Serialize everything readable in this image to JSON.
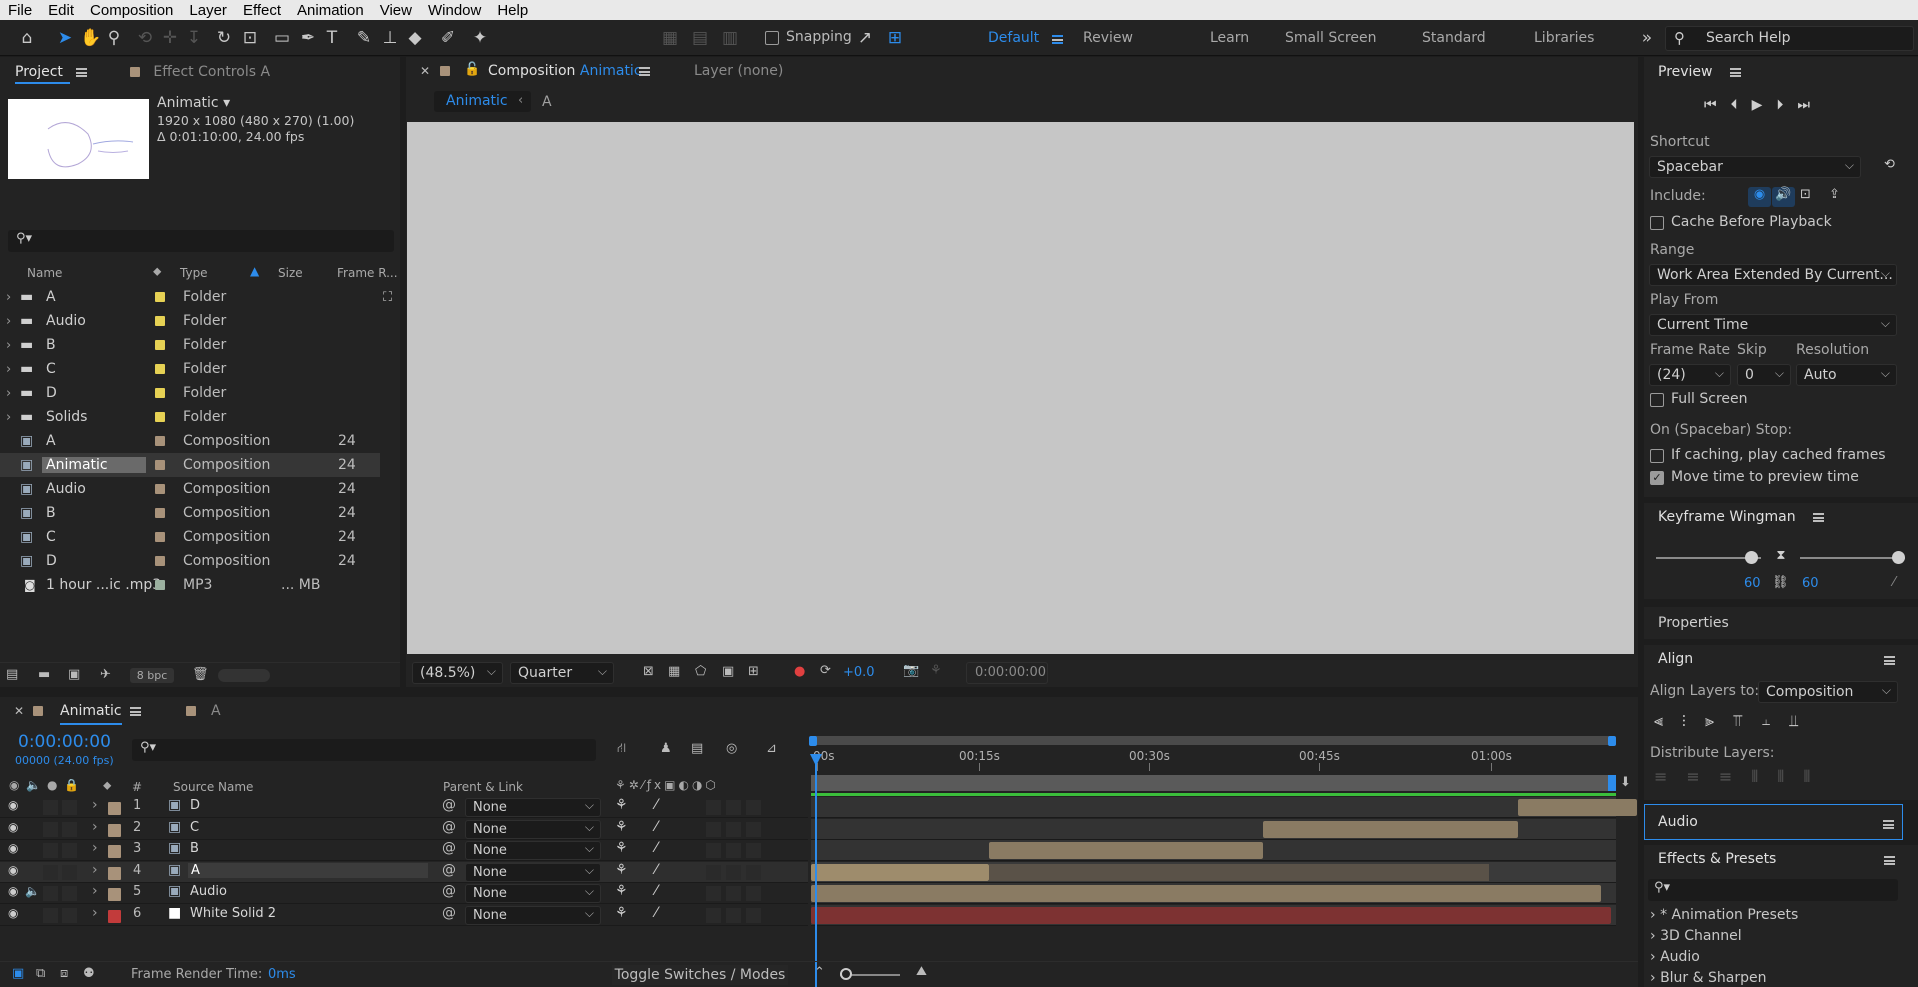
{
  "menu": [
    "File",
    "Edit",
    "Composition",
    "Layer",
    "Effect",
    "Animation",
    "View",
    "Window",
    "Help"
  ],
  "toolbar": {
    "snapping": "Snapping",
    "search_placeholder": "Search Help"
  },
  "workspaces": [
    {
      "label": "Default",
      "active": true
    },
    {
      "label": "Review"
    },
    {
      "label": "Learn"
    },
    {
      "label": "Small Screen"
    },
    {
      "label": "Standard"
    },
    {
      "label": "Libraries"
    }
  ],
  "project": {
    "tab_project": "Project",
    "tab_effect": "Effect Controls A",
    "comp_name": "Animatic",
    "comp_res": "1920 x 1080  (480 x 270) (1.00)",
    "comp_dur": "Δ 0:01:10:00, 24.00 fps",
    "columns": [
      "Name",
      "Type",
      "Size",
      "Frame R..."
    ],
    "bpc": "8 bpc",
    "items": [
      {
        "name": "A",
        "type": "Folder",
        "kind": "folder",
        "color": "#e6d154"
      },
      {
        "name": "Audio",
        "type": "Folder",
        "kind": "folder",
        "color": "#e6d154"
      },
      {
        "name": "B",
        "type": "Folder",
        "kind": "folder",
        "color": "#e6d154"
      },
      {
        "name": "C",
        "type": "Folder",
        "kind": "folder",
        "color": "#e6d154"
      },
      {
        "name": "D",
        "type": "Folder",
        "kind": "folder",
        "color": "#e6d154"
      },
      {
        "name": "Solids",
        "type": "Folder",
        "kind": "folder",
        "color": "#e6d154"
      },
      {
        "name": "A",
        "type": "Composition",
        "kind": "comp",
        "color": "#a8927a",
        "fr": "24"
      },
      {
        "name": "Animatic",
        "type": "Composition",
        "kind": "comp",
        "color": "#a8927a",
        "fr": "24",
        "selected": true
      },
      {
        "name": "Audio",
        "type": "Composition",
        "kind": "comp",
        "color": "#a8927a",
        "fr": "24"
      },
      {
        "name": "B",
        "type": "Composition",
        "kind": "comp",
        "color": "#a8927a",
        "fr": "24"
      },
      {
        "name": "C",
        "type": "Composition",
        "kind": "comp",
        "color": "#a8927a",
        "fr": "24"
      },
      {
        "name": "D",
        "type": "Composition",
        "kind": "comp",
        "color": "#a8927a",
        "fr": "24"
      },
      {
        "name": "1 hour ...ic .mp3",
        "type": "MP3",
        "kind": "mp3",
        "color": "#9bb09f",
        "size": "... MB"
      }
    ]
  },
  "composition": {
    "tab_prefix": "Composition",
    "tab_name": "Animatic",
    "layer_tab": "Layer  (none)",
    "crumbs": [
      "Animatic",
      "A"
    ],
    "zoom": "(48.5%)",
    "quality": "Quarter",
    "exposure": "+0.0",
    "timecode": "0:00:00:00"
  },
  "timeline": {
    "tab": "Animatic",
    "tab2": "A",
    "time": "0:00:00:00",
    "frames": "00000 (24.00 fps)",
    "col_source": "Source Name",
    "col_parent": "Parent & Link",
    "col_num": "#",
    "ticks": [
      "00s",
      "00:15s",
      "00:30s",
      "00:45s",
      "01:00s"
    ],
    "layers": [
      {
        "num": "1",
        "name": "D",
        "parent": "None",
        "color": "#a8927a",
        "bar_start": 707,
        "bar_end": 826
      },
      {
        "num": "2",
        "name": "C",
        "parent": "None",
        "color": "#a8927a",
        "bar_start": 452,
        "bar_end": 707
      },
      {
        "num": "3",
        "name": "B",
        "parent": "None",
        "color": "#a8927a",
        "bar_start": 178,
        "bar_end": 452
      },
      {
        "num": "4",
        "name": "A",
        "parent": "None",
        "color": "#a8927a",
        "bar_start": 0,
        "bar_end": 178,
        "selected": true
      },
      {
        "num": "5",
        "name": "Audio",
        "parent": "None",
        "color": "#a8927a",
        "bar_start": 0,
        "bar_end": 790
      },
      {
        "num": "6",
        "name": "White Solid 2",
        "parent": "None",
        "color": "#c23b3b",
        "bar_start": 0,
        "bar_end": 800
      }
    ],
    "render_label": "Frame Render Time:",
    "render_value": "0ms",
    "toggle": "Toggle Switches / Modes"
  },
  "preview": {
    "title": "Preview",
    "shortcut_label": "Shortcut",
    "shortcut": "Spacebar",
    "include": "Include:",
    "cache": "Cache Before Playback",
    "range_label": "Range",
    "range": "Work Area Extended By Current...",
    "playfrom_label": "Play From",
    "playfrom": "Current Time",
    "fr_label": "Frame Rate",
    "skip_label": "Skip",
    "res_label": "Resolution",
    "fr": "(24)",
    "skip": "0",
    "res": "Auto",
    "fullscreen": "Full Screen",
    "stop_label": "On (Spacebar) Stop:",
    "caching": "If caching, play cached frames",
    "movetime": "Move time to preview time"
  },
  "wingman": {
    "title": "Keyframe Wingman",
    "left_val": "60",
    "right_val": "60",
    "left_pos": 0.45,
    "right_pos": 0.55
  },
  "properties": {
    "title": "Properties"
  },
  "align": {
    "title": "Align",
    "layers_to_label": "Align Layers to:",
    "layers_to": "Composition",
    "distribute": "Distribute Layers:"
  },
  "audio": {
    "title": "Audio"
  },
  "effects": {
    "title": "Effects & Presets",
    "items": [
      "* Animation Presets",
      "3D Channel",
      "Audio",
      "Blur & Sharpen"
    ]
  }
}
